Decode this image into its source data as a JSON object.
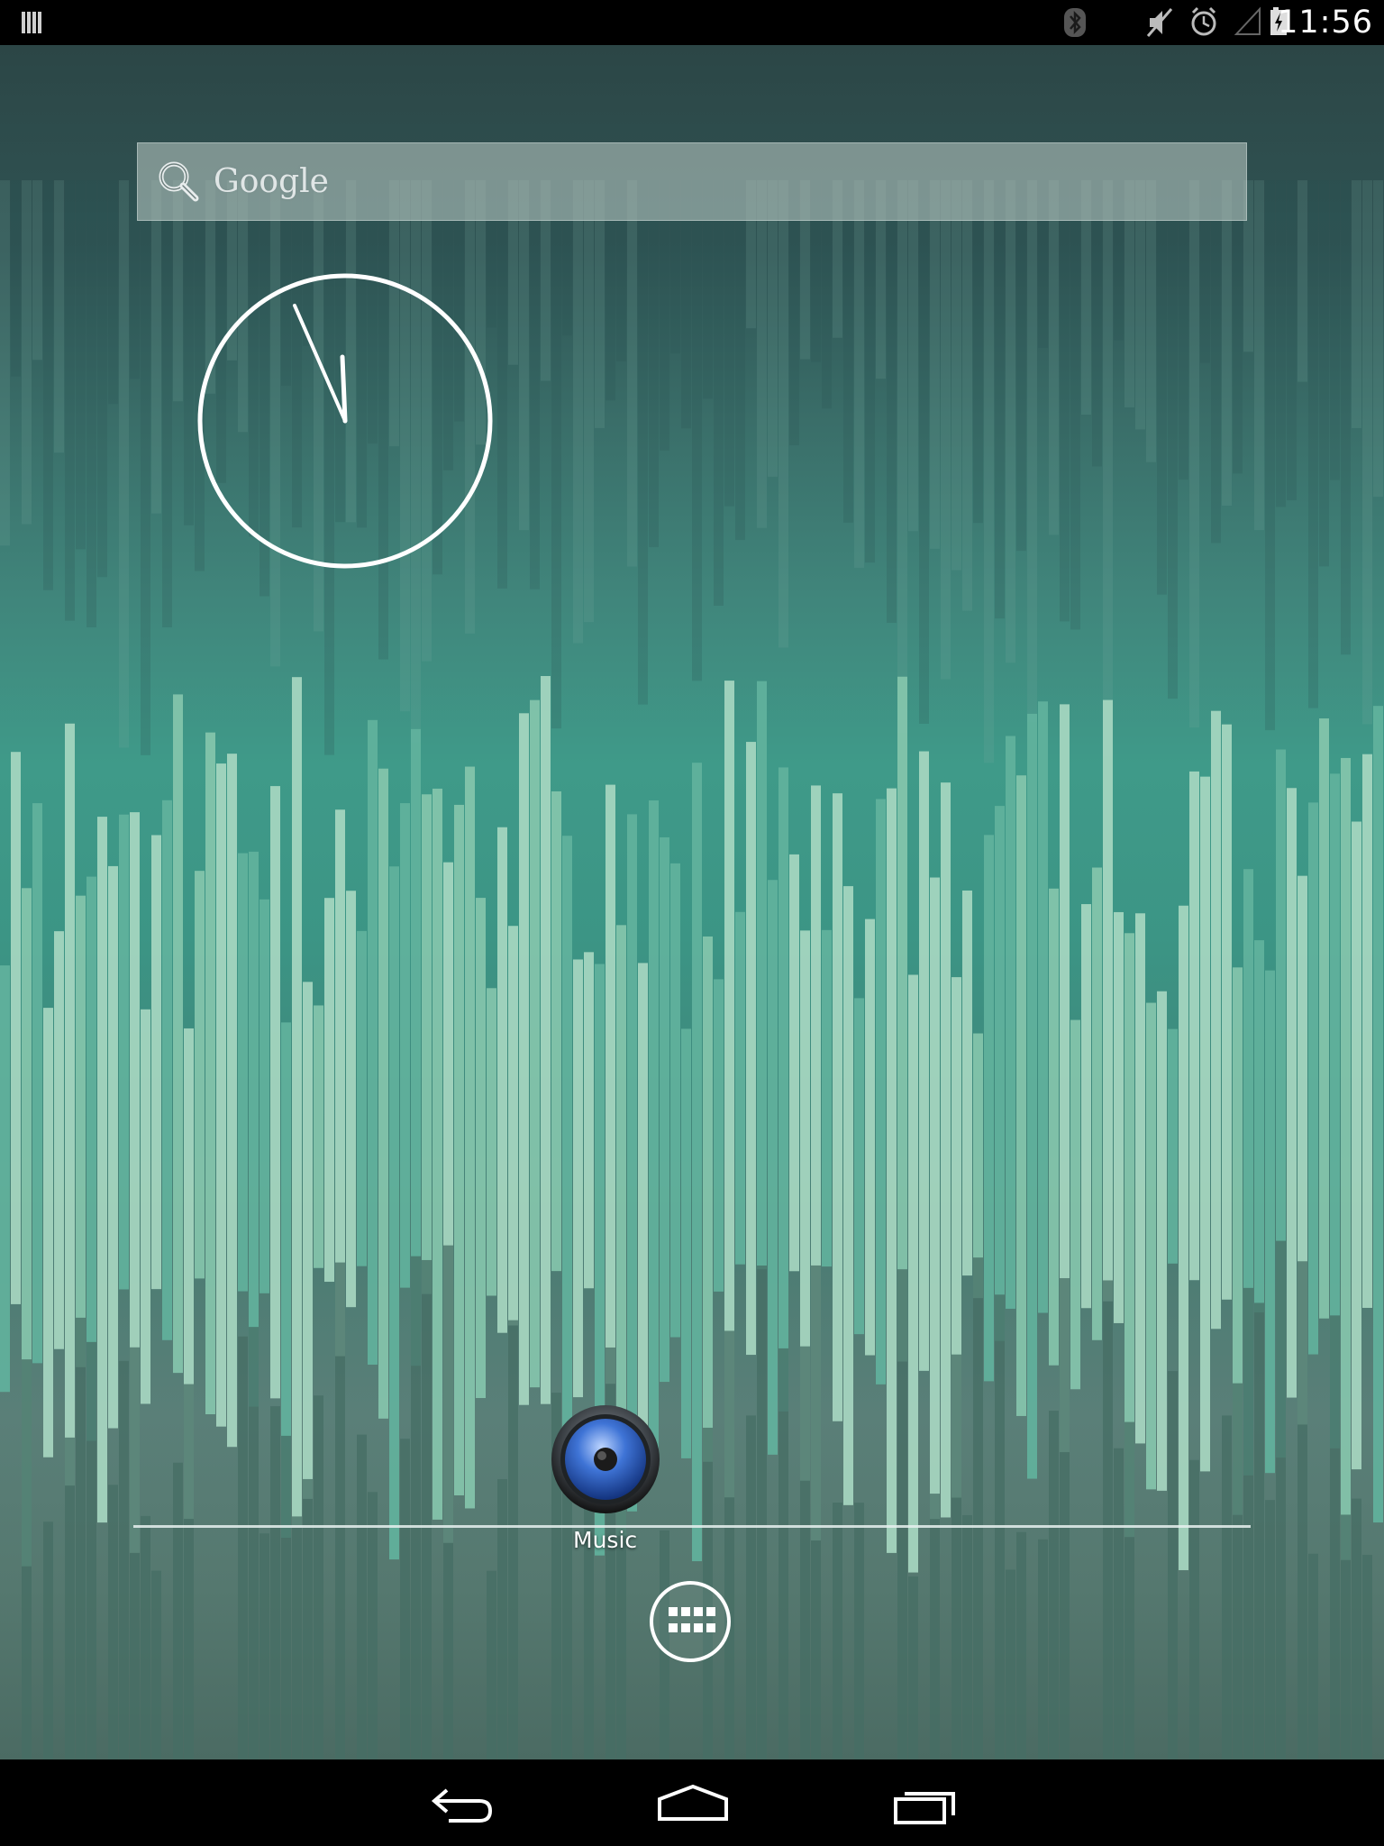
{
  "status_bar": {
    "time": "11:56",
    "icons": [
      "notification-icon",
      "bluetooth-icon",
      "mute-icon",
      "alarm-icon",
      "signal-icon",
      "battery-charging-icon"
    ]
  },
  "search": {
    "label": "Google",
    "icon": "search-icon"
  },
  "clock": {
    "type": "analog",
    "hour": 11,
    "minute": 56
  },
  "dock": {
    "apps": [
      {
        "label": "Music",
        "icon": "speaker-icon"
      }
    ],
    "all_apps_icon": "grid-icon"
  },
  "nav_bar": {
    "buttons": [
      "back-icon",
      "home-icon",
      "recents-icon"
    ]
  },
  "colors": {
    "status_bar_bg": "#000000",
    "wallpaper_top": "#2c4646",
    "wallpaper_mid": "#3f9a89",
    "wallpaper_bottom": "#4b6b63",
    "bar_light": "#a8d8c2",
    "bar_mid": "#62b39d",
    "music_icon_blue": "#2f5fc8"
  }
}
